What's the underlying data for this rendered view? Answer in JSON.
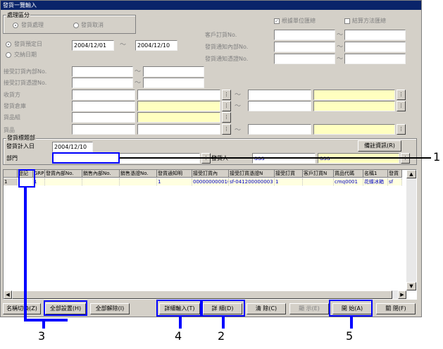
{
  "window": {
    "title": "發貨一覽輸入"
  },
  "processing": {
    "group_label": "處理區分",
    "opt_send_process": "發貨處理",
    "opt_send_cancel": "發貨取消",
    "chk_confirm_unit": "根據單位匯總",
    "chk_settlement": "結算方法匯總"
  },
  "dates": {
    "opt_scheduled": "發貨預定日",
    "opt_delivery": "交納日期",
    "date_from": "2004/12/01",
    "date_to": "2004/12/10",
    "tilde": "～"
  },
  "filters": {
    "customer_order_no": "客戶訂貨No.",
    "ship_notice_dept_no": "發貨通知內部No.",
    "ship_notice_voucher_no": "發貨通知憑證No.",
    "order_dept_no": "接受訂貨內部No.",
    "order_voucher_no": "接受訂貨憑證No.",
    "receiver": "收貨方",
    "warehouse": "發貨倉庫",
    "goods_group": "貨品組",
    "goods": "貨品"
  },
  "header_section": {
    "group_label": "發貨標題部",
    "plan_date_label": "發貨計入日",
    "plan_date_value": "2004/12/10",
    "dept_label": "部門",
    "shipper_label": "發貨人",
    "shipper_code": "aaa",
    "shipper_name": "aaa",
    "remarks_button": "備註資訊(R)"
  },
  "grid": {
    "columns": [
      "登記",
      "GRP",
      "發貨內部No.",
      "銷售內部No.",
      "銷售憑證No.",
      "發貨通知明",
      "接受訂貨內",
      "接受訂貨憑證N",
      "接受訂貨",
      "客戶訂貨N",
      "貨品代碼",
      "名稱1",
      "發貨"
    ],
    "rows": [
      [
        "1",
        "",
        "1",
        "",
        "",
        "",
        "1",
        "000000000010",
        "sf-041200000003",
        "1",
        "",
        "cmq0001",
        "花蝶冰箱",
        "sf"
      ]
    ]
  },
  "buttons": {
    "name_toggle": "名稱切換(Z)",
    "select_all": "全部設置(H)",
    "clear_all": "全部解除(I)",
    "detail_input": "詳細輸入(T)",
    "detail": "詳  細(D)",
    "clear": "清  除(C)",
    "show": "顯  示(E)",
    "start": "開  始(A)",
    "close": "關  閉(F)"
  },
  "callouts": [
    "1",
    "2",
    "3",
    "4",
    "5"
  ]
}
